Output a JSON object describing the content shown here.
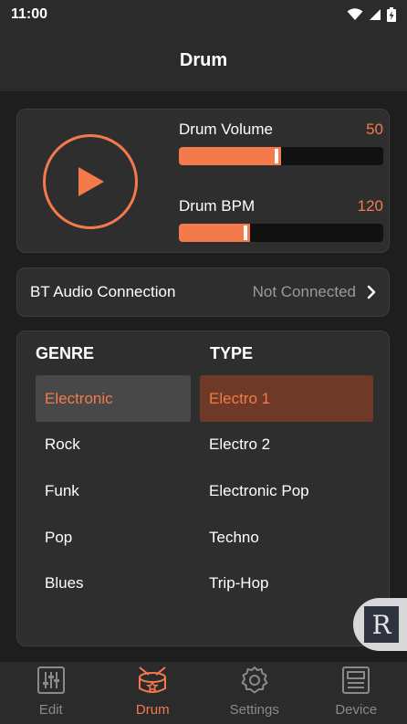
{
  "status_bar": {
    "time": "11:00"
  },
  "app_bar": {
    "title": "Drum"
  },
  "drum": {
    "volume": {
      "label": "Drum Volume",
      "value": "50",
      "fill": 0.5
    },
    "bpm": {
      "label": "Drum BPM",
      "value": "120",
      "fill": 0.35
    }
  },
  "bt": {
    "label": "BT Audio Connection",
    "status": "Not Connected"
  },
  "genre": {
    "header": "GENRE",
    "items": [
      "Electronic",
      "Rock",
      "Funk",
      "Pop",
      "Blues"
    ],
    "selected": 0
  },
  "type": {
    "header": "TYPE",
    "items": [
      "Electro 1",
      "Electro 2",
      "Electronic Pop",
      "Techno",
      "Trip-Hop"
    ],
    "selected": 0
  },
  "badge": {
    "letter": "R"
  },
  "nav": {
    "items": [
      {
        "label": "Edit",
        "icon": "sliders-icon"
      },
      {
        "label": "Drum",
        "icon": "drum-icon"
      },
      {
        "label": "Settings",
        "icon": "gear-icon"
      },
      {
        "label": "Device",
        "icon": "device-icon"
      }
    ],
    "active": 1
  },
  "colors": {
    "accent": "#f47a4c",
    "background": "#1e1e1e",
    "card": "#2e2e2e"
  }
}
